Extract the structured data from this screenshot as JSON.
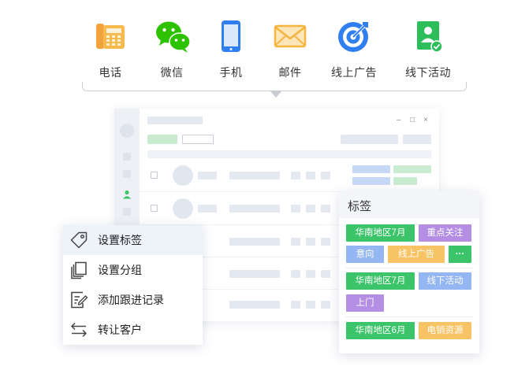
{
  "channels": [
    {
      "label": "电话",
      "icon": "desk-phone-icon"
    },
    {
      "label": "微信",
      "icon": "wechat-icon"
    },
    {
      "label": "手机",
      "icon": "mobile-phone-icon"
    },
    {
      "label": "邮件",
      "icon": "envelope-icon"
    },
    {
      "label": "线上广告",
      "icon": "target-icon"
    },
    {
      "label": "线下活动",
      "icon": "contact-card-icon"
    }
  ],
  "window": {
    "controls": {
      "minimize": "–",
      "maximize": "□",
      "close": "×"
    }
  },
  "context_menu": {
    "items": [
      {
        "label": "设置标签",
        "icon": "tag-icon"
      },
      {
        "label": "设置分组",
        "icon": "stack-icon"
      },
      {
        "label": "添加跟进记录",
        "icon": "edit-note-icon"
      },
      {
        "label": "转让客户",
        "icon": "transfer-arrows-icon"
      }
    ]
  },
  "tags_panel": {
    "title": "标签",
    "groups": [
      [
        "华南地区7月",
        "重点关注",
        "意向",
        "线上广告",
        "···"
      ],
      [
        "华南地区7月",
        "线下活动",
        "上门"
      ],
      [
        "华南地区6月",
        "电销资源"
      ]
    ]
  },
  "colors": {
    "green": "#3cc46a",
    "purple": "#b38ee3",
    "blue": "#94b6f2",
    "orange": "#f8c365",
    "wechat": "#2dc100",
    "accent_blue": "#2f7ff0"
  }
}
